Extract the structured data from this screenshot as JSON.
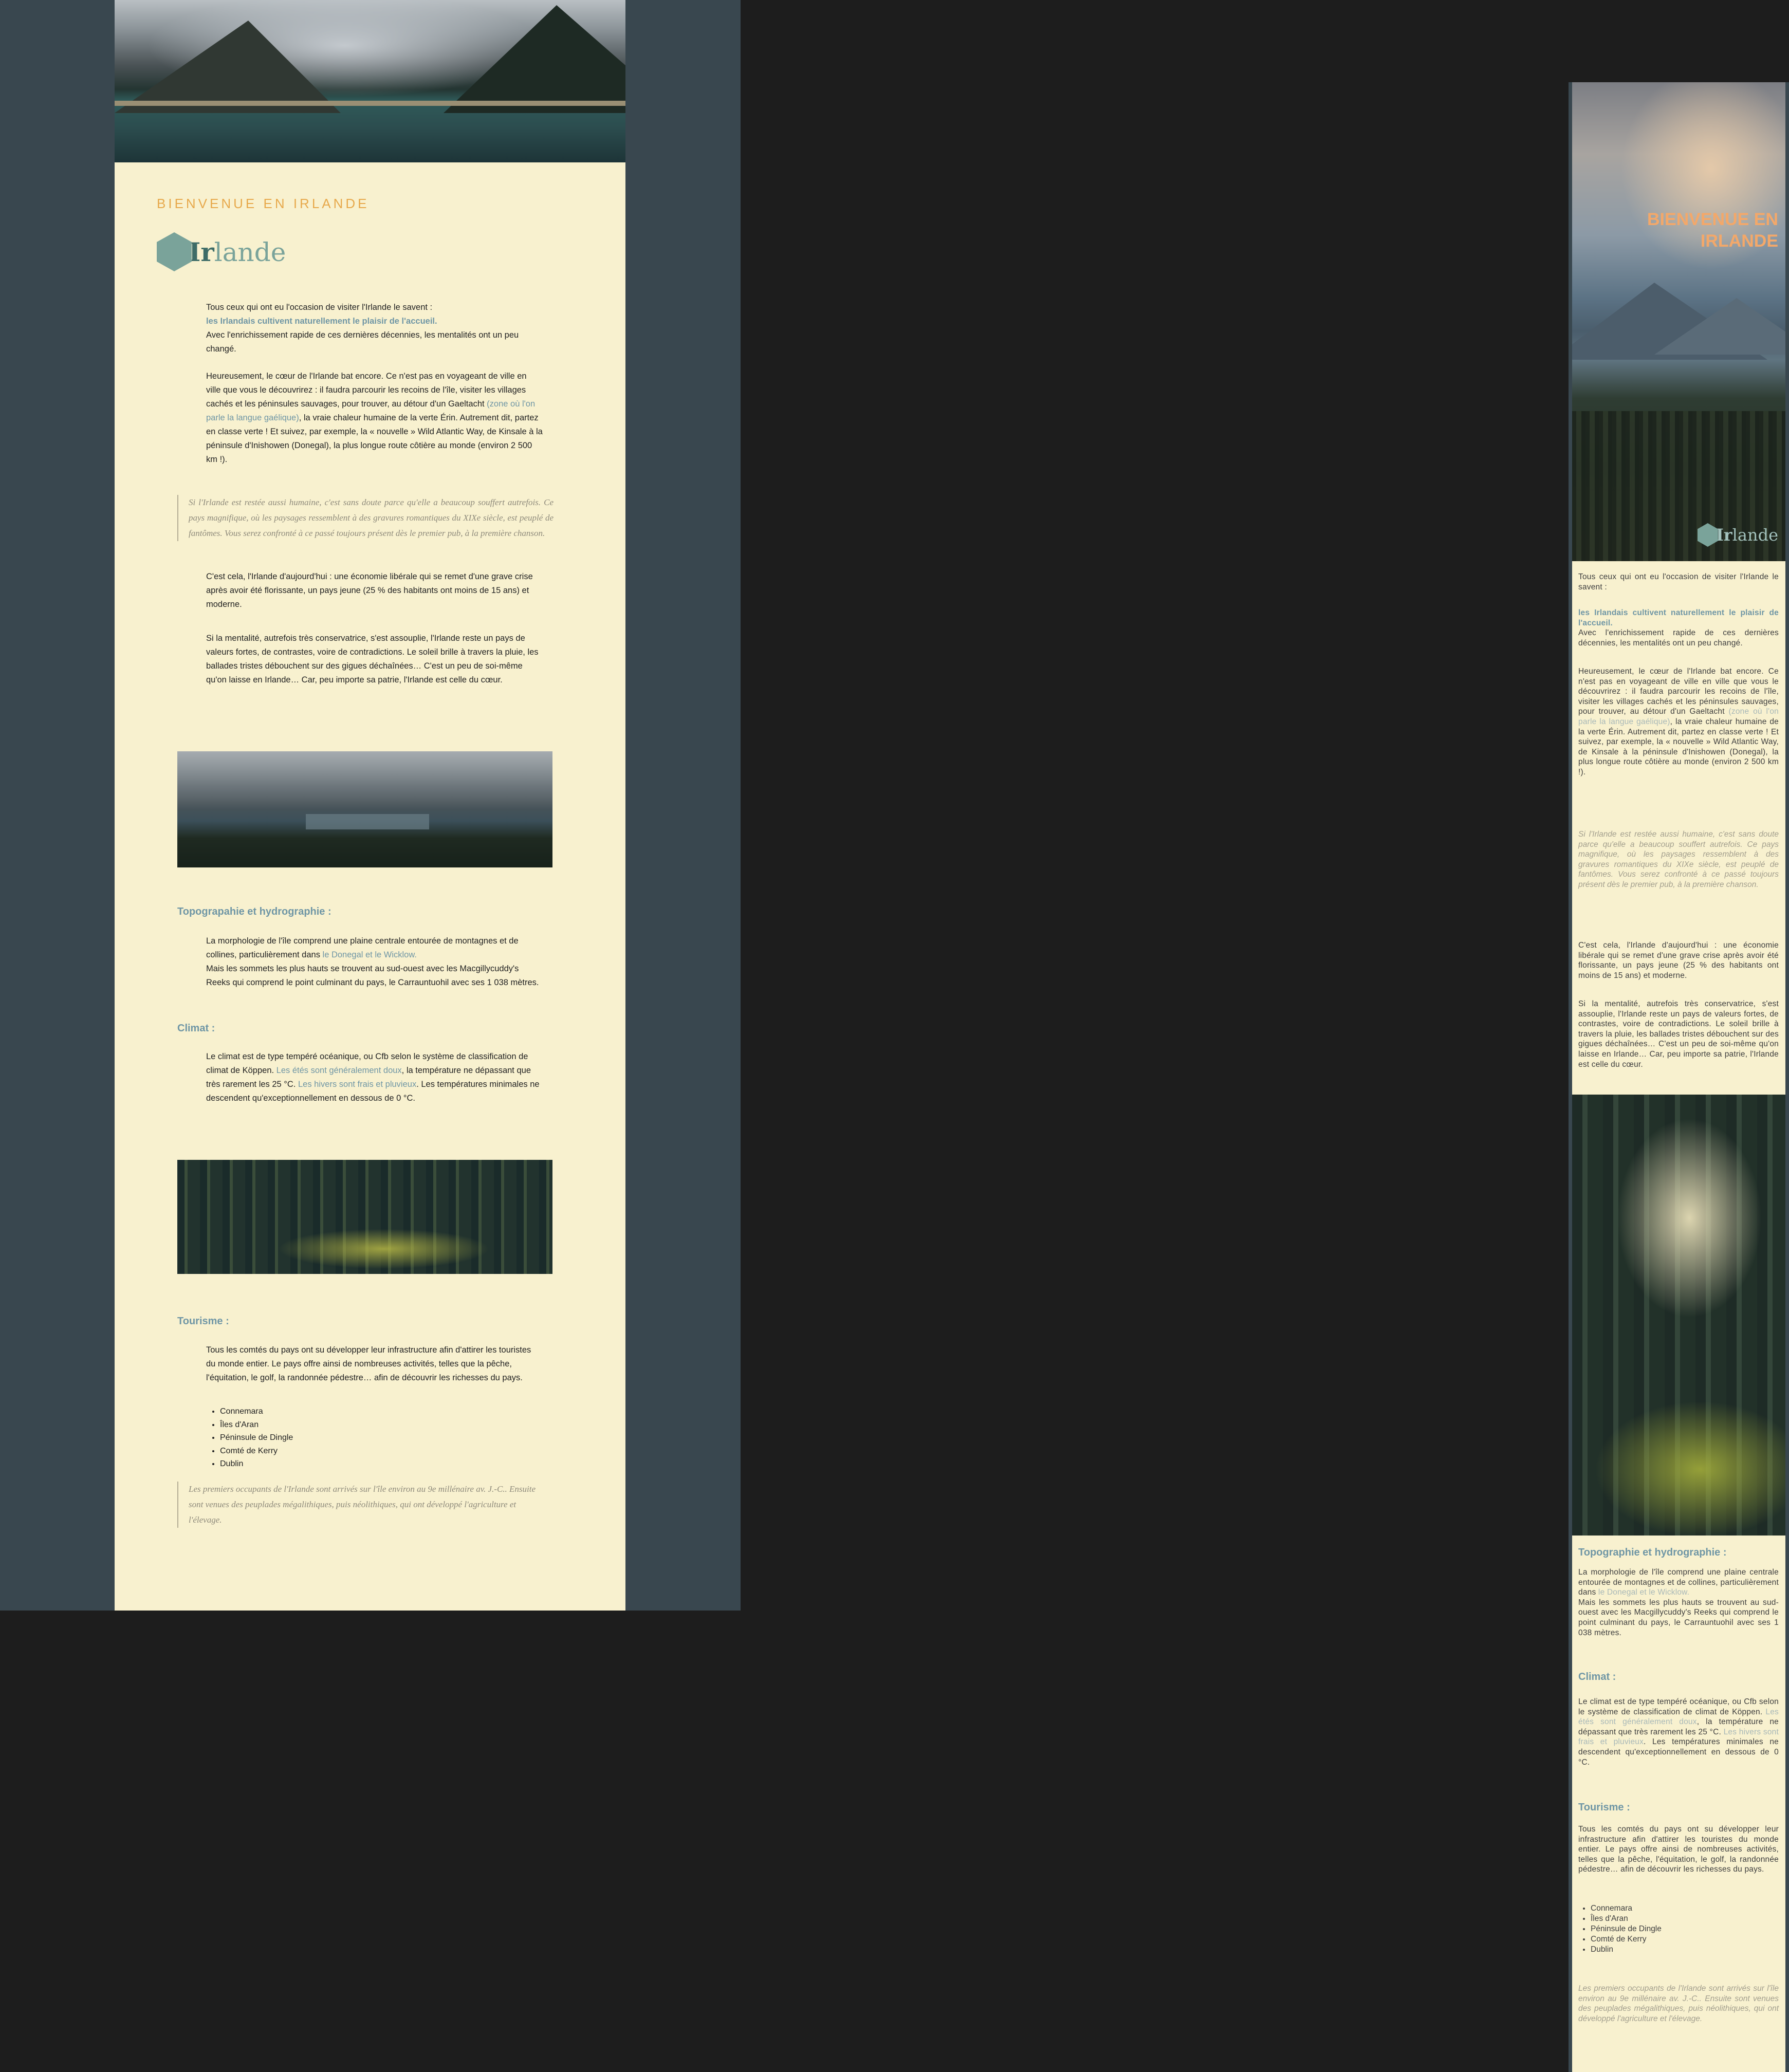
{
  "desktop": {
    "kicker": "BIENVENUE EN IRLANDE",
    "logo": {
      "initial": "Ir",
      "rest": "lande"
    },
    "intro": {
      "line1": "Tous ceux qui ont eu l'occasion de visiter l'Irlande le savent :",
      "highlight": "les Irlandais cultivent naturellement le plaisir de l'accueil.",
      "line3": "Avec l'enrichissement rapide de ces dernières décennies, les mentalités ont un peu changé."
    },
    "para2": {
      "before": "Heureusement, le cœur de l'Irlande bat encore. Ce n'est pas en voyageant de ville en ville que vous le découvrirez : il faudra parcourir les recoins de l'île, visiter les villages cachés et les péninsules sauvages, pour trouver, au détour d'un Gaeltacht ",
      "highlight": "(zone où l'on parle la langue gaélique)",
      "after": ", la vraie chaleur humaine de la verte Érin. Autrement dit, partez en classe verte ! Et suivez, par exemple, la « nouvelle » Wild Atlantic Way, de Kinsale à la péninsule d'Inishowen (Donegal), la plus longue route côtière au monde (environ 2 500 km !)."
    },
    "quote1": "Si l'Irlande est restée aussi humaine, c'est sans doute parce qu'elle a beaucoup souffert autrefois. Ce pays magnifique, où les paysages ressemblent à des gravures romantiques du XIXe siècle, est peuplé de fantômes. Vous serez confronté à ce passé toujours présent dès le premier pub, à la première chanson.",
    "para3": "C'est cela, l'Irlande d'aujourd'hui : une économie libérale qui se remet d'une grave crise après avoir été florissante, un pays jeune (25 % des habitants ont moins de 15 ans) et moderne.",
    "para4": "Si la mentalité, autrefois très conservatrice, s'est assouplie, l'Irlande reste un pays de valeurs fortes, de contrastes, voire de contradictions. Le soleil brille à travers la pluie, les ballades tristes débouchent sur des gigues déchaînées… C'est un peu de soi-même qu'on laisse en Irlande… Car, peu importe sa patrie, l'Irlande est celle du cœur.",
    "topo": {
      "heading": "Topograpahie et hydrographie :",
      "before": "La morphologie de l'île comprend une plaine centrale entourée de montagnes et de collines, particulièrement dans ",
      "highlight": "le Donegal et le Wicklow.",
      "after": "Mais les sommets les plus hauts se trouvent au sud-ouest avec les Macgillycuddy's Reeks qui comprend le point culminant du pays, le Carrauntuohil avec ses 1 038 mètres."
    },
    "climat": {
      "heading": "Climat :",
      "before": "Le climat est de type tempéré océanique, ou Cfb selon le système de classification de climat de Köppen. ",
      "highlight1": "Les étés sont généralement doux",
      "middle": ", la température ne dépassant que très rarement les 25 °C. ",
      "highlight2": "Les hivers sont frais et pluvieux",
      "after": ". Les températures minimales ne descendent qu'exceptionnellement en dessous de 0 °C."
    },
    "tourisme": {
      "heading": "Tourisme :",
      "text": "Tous les comtés du pays ont su développer leur infrastructure afin d'attirer les touristes du monde entier. Le pays offre ainsi de nombreuses activités, telles que la pêche, l'équitation, le golf, la randonnée pédestre… afin de découvrir les richesses du pays.",
      "places": [
        "Connemara",
        "Îles d'Aran",
        "Péninsule de Dingle",
        "Comté de Kerry",
        "Dublin"
      ]
    },
    "quote2": "Les premiers occupants de l'Irlande sont arrivés sur l'île environ au 9e millénaire av. J.-C.. Ensuite sont venues des peuplades mégalithiques, puis néolithiques, qui ont développé l'agriculture et l'élevage."
  },
  "mobile": {
    "title": "BIENVENUE EN IRLANDE",
    "logo": {
      "initial": "Ir",
      "rest": "lande"
    },
    "intro_line1": "Tous ceux qui ont eu l'occasion de visiter l'Irlande le savent :",
    "intro_highlight": "les Irlandais cultivent naturellement le plaisir de l'accueil.",
    "intro_line3": "Avec l'enrichissement rapide de ces dernières décennies, les mentalités ont un peu changé.",
    "para2_before": "Heureusement, le cœur de l'Irlande bat encore. Ce n'est pas en voyageant de ville en ville que vous le découvrirez : il faudra parcourir les recoins de l'île, visiter les villages cachés et les péninsules sauvages, pour trouver, au détour d'un Gaeltacht ",
    "para2_highlight": "(zone où l'on parle la langue gaélique)",
    "para2_after": ", la vraie chaleur humaine de la verte Érin. Autrement dit, partez en classe verte ! Et suivez, par exemple, la « nouvelle » Wild Atlantic Way, de Kinsale à la péninsule d'Inishowen (Donegal), la plus longue route côtière au monde (environ 2 500 km !).",
    "quote1": "Si l'Irlande est restée aussi humaine, c'est sans doute parce qu'elle a beaucoup souffert autrefois. Ce pays magnifique, où les paysages ressemblent à des gravures romantiques du XIXe siècle, est peuplé de fantômes. Vous serez confronté à ce passé toujours présent dès le premier pub, à la première chanson.",
    "para3": "C'est cela, l'Irlande d'aujourd'hui : une économie libérale qui se remet d'une grave crise après avoir été florissante, un pays jeune (25 % des habitants ont moins de 15 ans) et moderne.",
    "para4": "Si la mentalité, autrefois très conservatrice, s'est assouplie, l'Irlande reste un pays de valeurs fortes, de contrastes, voire de contradictions. Le soleil brille à travers la pluie, les ballades tristes débouchent sur des gigues déchaînées… C'est un peu de soi-même qu'on laisse en Irlande… Car, peu importe sa patrie, l'Irlande est celle du cœur.",
    "topo_heading": "Topographie et hydrographie :",
    "topo_before": "La morphologie de l'île comprend une plaine centrale entourée de montagnes et de collines, particulièrement dans ",
    "topo_highlight": "le Donegal et le Wicklow.",
    "topo_after": "Mais les sommets les plus hauts se trouvent au sud-ouest avec les Macgillycuddy's Reeks qui comprend le point culminant du pays, le Carrauntuohil avec ses 1 038 mètres.",
    "climat_heading": "Climat :",
    "climat_before": "Le climat est de type tempéré océanique, ou Cfb selon le système de classification de climat de Köppen. ",
    "climat_highlight1": "Les étés sont généralement doux",
    "climat_middle": ", la température ne dépassant que très rarement les 25 °C. ",
    "climat_highlight2": "Les hivers sont frais et pluvieux",
    "climat_after": ". Les températures minimales ne descendent qu'exceptionnellement en dessous de 0 °C.",
    "tourisme_heading": "Tourisme :",
    "tourisme_text": "Tous les comtés du pays ont su développer leur infrastructure afin d'attirer les touristes du monde entier. Le pays offre ainsi de nombreuses activités, telles que la pêche, l'équitation, le golf, la randonnée pédestre… afin de découvrir les richesses du pays.",
    "places": [
      "Connemara",
      "Îles d'Aran",
      "Péninsule de Dingle",
      "Comté de Kerry",
      "Dublin"
    ],
    "quote2": "Les premiers occupants de l'Irlande sont arrivés sur l'île environ au 9e millénaire av. J.-C.. Ensuite sont venues des peuplades mégalithiques, puis néolithiques, qui ont développé l'agriculture et l'élevage."
  },
  "colors": {
    "accent": "#6f96a5",
    "kicker": "#e7a94c",
    "cream": "#f8f1cf",
    "slate": "#39474f"
  }
}
